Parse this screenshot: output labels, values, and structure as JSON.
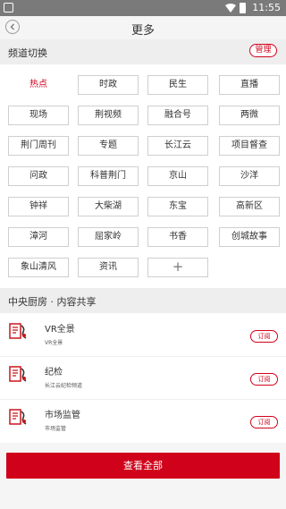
{
  "status_bar": {
    "time": "11:55"
  },
  "header": {
    "title": "更多"
  },
  "channel_section": {
    "title": "频道切换",
    "manage_label": "管理"
  },
  "channels": [
    "热点",
    "时政",
    "民生",
    "直播",
    "现场",
    "荆视频",
    "融合号",
    "两微",
    "荆门周刊",
    "专题",
    "长江云",
    "项目督查",
    "问政",
    "科普荆门",
    "京山",
    "沙洋",
    "钟祥",
    "大柴湖",
    "东宝",
    "高新区",
    "漳河",
    "屈家岭",
    "书香",
    "创城故事",
    "象山清风",
    "资讯"
  ],
  "active_channel": "热点",
  "add_symbol": "+",
  "kitchen_section": {
    "title": "中央厨房 · 内容共享"
  },
  "feeds": [
    {
      "name": "VR全景",
      "desc": "VR全景",
      "action": "订阅"
    },
    {
      "name": "纪检",
      "desc": "长江云纪检频道",
      "action": "订阅"
    },
    {
      "name": "市场监管",
      "desc": "市场监管",
      "action": "订阅"
    }
  ],
  "view_all_label": "查看全部",
  "colors": {
    "accent": "#d0021b",
    "statusbar": "#7a7a7a",
    "background": "#f5f5f5"
  }
}
